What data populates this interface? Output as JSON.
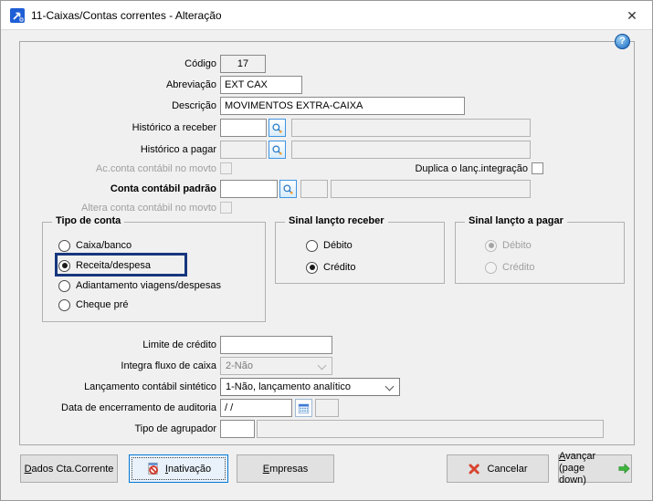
{
  "window": {
    "title": "11-Caixas/Contas correntes - Alteração",
    "close_glyph": "✕",
    "help_glyph": "?"
  },
  "colors": {
    "focus_highlight": "#17377e",
    "dialog_bg": "#f0f0f0",
    "titlebar_bg": "#ffffff",
    "button_focus_border": "#0078d7",
    "cancel_red": "#d8432f",
    "advance_green": "#3db53d",
    "help_blue": "#1565c0",
    "lookup_blue": "#2e7cc4"
  },
  "fields": {
    "codigo": {
      "label": "Código",
      "value": "17"
    },
    "abreviacao": {
      "label": "Abreviação",
      "value": "EXT CAX"
    },
    "descricao": {
      "label": "Descrição",
      "value": "MOVIMENTOS EXTRA-CAIXA"
    },
    "historico_receber": {
      "label": "Histórico a receber",
      "code": "",
      "desc": ""
    },
    "historico_pagar": {
      "label": "Histórico a pagar",
      "code": "",
      "desc": ""
    },
    "ac_conta_movto": {
      "label": "Ac.conta contábil no movto",
      "checked": false
    },
    "duplica_lanc": {
      "label": "Duplica o lanç.integração",
      "checked": false
    },
    "conta_padrao": {
      "label": "Conta contábil padrão",
      "code": "",
      "aux": "",
      "desc": ""
    },
    "altera_conta_movto": {
      "label": "Altera conta contábil no movto",
      "checked": false
    },
    "limite_credito": {
      "label": "Limite de crédito",
      "value": ""
    },
    "integra_fluxo": {
      "label": "Integra fluxo de caixa",
      "value": "2-Não",
      "disabled": true
    },
    "lancamento_sintetico": {
      "label": "Lançamento contábil sintético",
      "value": "1-Não, lançamento analítico"
    },
    "data_encerramento": {
      "label": "Data de encerramento de auditoria",
      "value": "/ /",
      "aux": ""
    },
    "tipo_agrupador": {
      "label": "Tipo de agrupador",
      "value": "",
      "desc": ""
    }
  },
  "groups": {
    "tipo_conta": {
      "title": "Tipo de conta",
      "options": [
        "Caixa/banco",
        "Receita/despesa",
        "Adiantamento viagens/despesas",
        "Cheque pré"
      ],
      "selected_index": 1
    },
    "sinal_receber": {
      "title": "Sinal lançto receber",
      "options": [
        "Débito",
        "Crédito"
      ],
      "selected_index": 1
    },
    "sinal_pagar": {
      "title": "Sinal lançto a pagar",
      "options": [
        "Débito",
        "Crédito"
      ],
      "selected_index": 0,
      "disabled": true
    }
  },
  "buttons": {
    "dados_cta": {
      "key": "D",
      "rest": "ados Cta.Corrente"
    },
    "inativacao": {
      "key": "I",
      "rest": "nativação"
    },
    "empresas": {
      "key": "E",
      "rest": "mpresas"
    },
    "cancelar": {
      "label": "Cancelar"
    },
    "avancar": {
      "key": "A",
      "rest": "vançar",
      "line2": "(page down)"
    }
  },
  "icons": {
    "app": "app-logo-arrow",
    "close": "close-x",
    "help": "help-question",
    "lookup": "magnifier-search",
    "calendar": "calendar-picker",
    "inativacao": "document-blocked",
    "cancelar": "red-x",
    "avancar": "green-arrow-right"
  }
}
